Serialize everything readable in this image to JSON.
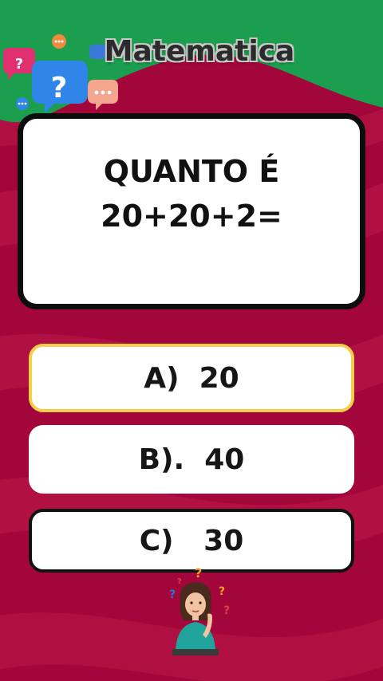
{
  "title": "Matematica",
  "question": {
    "line1": "QUANTO É",
    "line2": "20+20+2="
  },
  "options": [
    {
      "label": "A)  20",
      "state": "highlighted"
    },
    {
      "label": "B).  40",
      "state": "normal"
    },
    {
      "label": "C)   30",
      "state": "normal"
    }
  ],
  "decorations": {
    "bubble_icons": [
      "speech-bubble-question-icon",
      "speech-bubble-dots-icon",
      "speech-bubble-ellipsis-icon"
    ],
    "character": "thinking-woman-icon"
  },
  "colors": {
    "background": "#a2063a",
    "header_green": "#1b9e4e",
    "card": "#ffffff",
    "card_border": "#0d0d0d",
    "highlight_border": "#f5cf4c"
  }
}
